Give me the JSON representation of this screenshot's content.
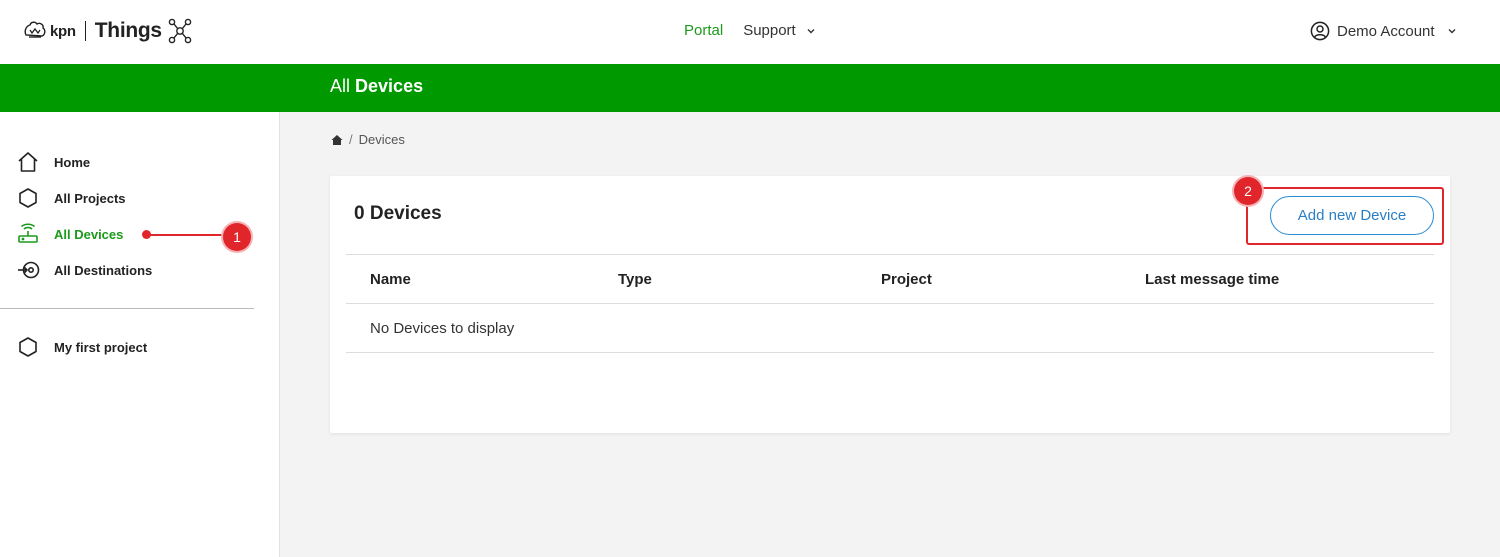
{
  "header": {
    "brand": "kpn",
    "product": "Things",
    "nav": [
      {
        "label": "Portal"
      },
      {
        "label": "Support"
      }
    ],
    "account_label": "Demo Account"
  },
  "banner": {
    "title_prefix": "All",
    "title_bold": "Devices"
  },
  "sidebar": {
    "items": [
      {
        "label": "Home",
        "icon": "home-icon"
      },
      {
        "label": "All Projects",
        "icon": "hexagon-icon"
      },
      {
        "label": "All Devices",
        "icon": "router-icon",
        "active": true
      },
      {
        "label": "All Destinations",
        "icon": "destination-icon"
      }
    ],
    "projects": [
      {
        "label": "My first project",
        "icon": "hexagon-icon"
      }
    ]
  },
  "breadcrumb": {
    "current": "Devices"
  },
  "card": {
    "title": "0 Devices",
    "add_button": "Add new Device",
    "columns": [
      "Name",
      "Type",
      "Project",
      "Last message time"
    ],
    "empty_text": "No Devices to display"
  },
  "annotations": {
    "badge_1": "1",
    "badge_2": "2"
  },
  "colors": {
    "brand_green": "#009900",
    "active_green": "#1b9a1b",
    "button_blue": "#2a7fc4",
    "annotation_red": "#e0252b"
  }
}
